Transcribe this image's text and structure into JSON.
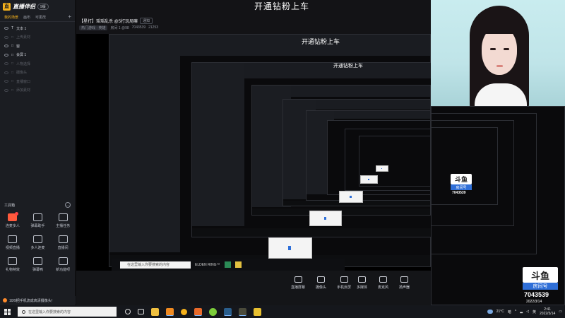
{
  "app": {
    "brand": "直播伴侣",
    "version": "9版",
    "scene_tabs": [
      "我的场景",
      "画布",
      "可更改"
    ],
    "active_scene_tab": 0,
    "layers": [
      {
        "type": "T",
        "name": "文本 1",
        "visible": true
      },
      {
        "type": "□",
        "name": "上传素材",
        "visible": false
      },
      {
        "type": "□",
        "name": "窗",
        "visible": true
      },
      {
        "type": "□",
        "name": "会屏 1",
        "visible": true
      },
      {
        "type": "□",
        "name": "人物选择",
        "visible": false
      },
      {
        "type": "□",
        "name": "摄像头",
        "visible": false
      },
      {
        "type": "□",
        "name": "直播窗口",
        "visible": false
      },
      {
        "type": "□",
        "name": "添加素材",
        "visible": false
      }
    ],
    "tools_title": "工具箱",
    "tools_more_icon": "more-icon",
    "tools": [
      {
        "label": "连麦多人",
        "icon": "link-mic-icon",
        "highlight": true,
        "dot": true
      },
      {
        "label": "弹幕助手",
        "icon": "danmaku-icon",
        "highlight": false,
        "dot": false
      },
      {
        "label": "主播任务",
        "icon": "task-icon",
        "highlight": false,
        "dot": false
      },
      {
        "label": "视频直播",
        "icon": "video-icon",
        "highlight": false,
        "dot": false
      },
      {
        "label": "多人连麦",
        "icon": "multi-mic-icon",
        "highlight": false,
        "dot": false
      },
      {
        "label": "直播间",
        "icon": "room-icon",
        "highlight": false,
        "dot": false
      },
      {
        "label": "礼物特效",
        "icon": "gift-icon",
        "highlight": false,
        "dot": false
      },
      {
        "label": "弹幕鸭",
        "icon": "duck-icon",
        "highlight": false,
        "dot": false
      },
      {
        "label": "新功能呀",
        "icon": "new-icon",
        "highlight": false,
        "dot": false
      }
    ],
    "notice": "10/9把手机流成高清摄像头!"
  },
  "preview": {
    "room_title": "【星打】瑶瑶乱杀 @5打玩局嘛",
    "room_tag": "通知",
    "room_info": [
      "热门游戏 · 英雄",
      "房间 1 @98",
      "7043539",
      "21253"
    ],
    "overlay_title": "开通钻粉上车",
    "nested_titles": [
      "开通钻粉上车",
      "开通钻粉上车"
    ],
    "nested_search": "在这里输入你要搜索的内容",
    "nested_app": "ELDEN RING™"
  },
  "controls": [
    {
      "label": "直播屏幕",
      "icon": "screen-icon"
    },
    {
      "label": "摄像头",
      "icon": "camera-icon"
    },
    {
      "label": "手机反屏",
      "icon": "phone-icon"
    },
    {
      "label": "多媒体",
      "icon": "media-icon"
    },
    {
      "label": "麦克风",
      "icon": "mic-icon"
    },
    {
      "label": "扬声器",
      "icon": "speaker-icon"
    }
  ],
  "camera": {
    "badge_top": "斗鱼",
    "badge_sub": "房间号",
    "room_number": "7043539",
    "date": "2022/3/14"
  },
  "taskbar": {
    "search_placeholder": "在这里输入你要搜索的内容",
    "temperature": "21°C",
    "weather": "暗",
    "ime": "英",
    "time": "2:41",
    "date": "2022/3/14"
  },
  "colors": {
    "accent": "#f6b21c",
    "highlight_red": "#ff5a3c",
    "badge_blue": "#2f6fd8"
  }
}
